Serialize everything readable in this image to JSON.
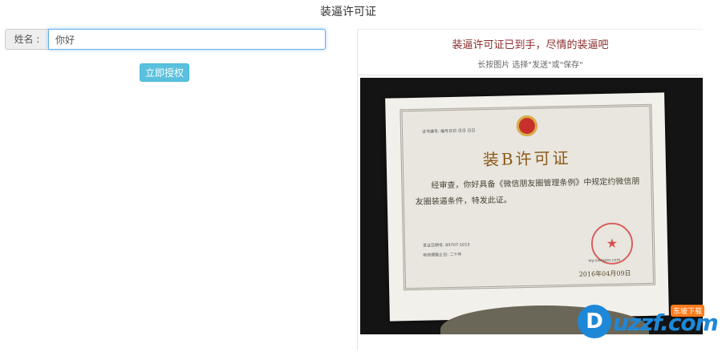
{
  "page": {
    "title": "装逼许可证"
  },
  "form": {
    "name_label": "姓名 :",
    "name_value": "你好",
    "submit_label": "立即授权"
  },
  "result": {
    "header": "装逼许可证已到手，尽情的装逼吧",
    "hint": "长按图片 选择\"发送\"或\"保存\"",
    "certificate": {
      "title": "装B许可证",
      "number_line": "证书编号: 编号日日 日日 日日",
      "body": "经审查，你好具备《微信朋友圈管理条例》中规定约微信朋友圈装逼条件，特发此证。",
      "meta_lines": [
        "发证日期号: 89707-1015",
        "有效期截止日: 二十年"
      ],
      "url": "wy.xieegoo.com",
      "date": "2016年04月09日"
    }
  },
  "watermark": {
    "letter": "D",
    "text": "uzzf.com",
    "badge": "东坡下载"
  },
  "colors": {
    "button": "#5bc0de",
    "header_text": "#8b2c2c",
    "input_focus": "#66afe9"
  }
}
